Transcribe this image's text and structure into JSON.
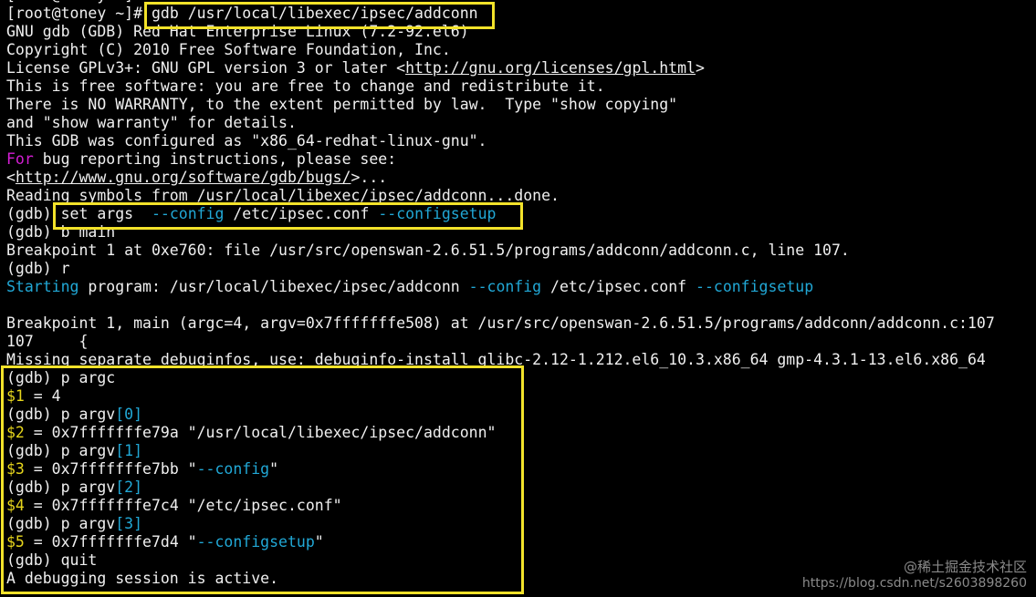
{
  "terminal": {
    "lines": [
      {
        "segments": [
          {
            "text": "[root@toney ~]#",
            "color": "white"
          }
        ]
      },
      {
        "segments": [
          {
            "text": "[root@toney ~]# ",
            "color": "white"
          },
          {
            "text": "gdb /usr/local/libexec/ipsec/addconn",
            "color": "white"
          }
        ]
      },
      {
        "segments": [
          {
            "text": "GNU gdb (GDB) Red Hat Enterprise Linux (7.2-92.el6)",
            "color": "white"
          }
        ]
      },
      {
        "segments": [
          {
            "text": "Copyright (C) 2010 Free Software Foundation, Inc.",
            "color": "white"
          }
        ]
      },
      {
        "segments": [
          {
            "text": "License GPLv3+: GNU GPL version 3 or later <",
            "color": "white"
          },
          {
            "text": "http://gnu.org/licenses/gpl.html",
            "color": "link"
          },
          {
            "text": ">",
            "color": "white"
          }
        ]
      },
      {
        "segments": [
          {
            "text": "This is free software: you are free to change and redistribute it.",
            "color": "white"
          }
        ]
      },
      {
        "segments": [
          {
            "text": "There is NO WARRANTY, to the extent permitted by law.  Type \"show copying\"",
            "color": "white"
          }
        ]
      },
      {
        "segments": [
          {
            "text": "and \"show warranty\" for details.",
            "color": "white"
          }
        ]
      },
      {
        "segments": [
          {
            "text": "This GDB was configured as \"x86_64-redhat-linux-gnu\".",
            "color": "white"
          }
        ]
      },
      {
        "segments": [
          {
            "text": "For",
            "color": "magenta"
          },
          {
            "text": " bug reporting instructions, please see:",
            "color": "white"
          }
        ]
      },
      {
        "segments": [
          {
            "text": "<",
            "color": "white"
          },
          {
            "text": "http://www.gnu.org/software/gdb/bugs/",
            "color": "link"
          },
          {
            "text": ">...",
            "color": "white"
          }
        ]
      },
      {
        "segments": [
          {
            "text": "Reading symbols from /usr/local/libexec/ipsec/addconn...done.",
            "color": "white"
          }
        ]
      },
      {
        "segments": [
          {
            "text": "(gdb) ",
            "color": "white"
          },
          {
            "text": "set args  ",
            "color": "white"
          },
          {
            "text": "--config",
            "color": "cyan"
          },
          {
            "text": " /etc/ipsec.conf ",
            "color": "white"
          },
          {
            "text": "--configsetup",
            "color": "cyan"
          }
        ]
      },
      {
        "segments": [
          {
            "text": "(gdb) b main",
            "color": "white"
          }
        ]
      },
      {
        "segments": [
          {
            "text": "Breakpoint 1 at 0xe760: file /usr/src/openswan-2.6.51.5/programs/addconn/addconn.c, line 107.",
            "color": "white"
          }
        ]
      },
      {
        "segments": [
          {
            "text": "(gdb) r",
            "color": "white"
          }
        ]
      },
      {
        "segments": [
          {
            "text": "Starting",
            "color": "cyan"
          },
          {
            "text": " program: /usr/local/libexec/ipsec/addconn ",
            "color": "white"
          },
          {
            "text": "--config",
            "color": "cyan"
          },
          {
            "text": " /etc/ipsec.conf ",
            "color": "white"
          },
          {
            "text": "--configsetup",
            "color": "cyan"
          }
        ]
      },
      {
        "segments": [
          {
            "text": "",
            "color": "white"
          }
        ]
      },
      {
        "segments": [
          {
            "text": "Breakpoint 1, main (argc=4, argv=0x7fffffffe508) at /usr/src/openswan-2.6.51.5/programs/addconn/addconn.c:107",
            "color": "white"
          }
        ]
      },
      {
        "segments": [
          {
            "text": "107     {",
            "color": "white"
          }
        ]
      },
      {
        "segments": [
          {
            "text": "Missing separate debuginfos, use: debuginfo-install glibc-2.12-1.212.el6_10.3.x86_64 gmp-4.3.1-13.el6.x86_64",
            "color": "white"
          }
        ]
      },
      {
        "segments": [
          {
            "text": "(gdb) p argc",
            "color": "white"
          }
        ]
      },
      {
        "segments": [
          {
            "text": "$1",
            "color": "yellow"
          },
          {
            "text": " = 4",
            "color": "white"
          }
        ]
      },
      {
        "segments": [
          {
            "text": "(gdb) p argv",
            "color": "white"
          },
          {
            "text": "[0]",
            "color": "cyan"
          }
        ]
      },
      {
        "segments": [
          {
            "text": "$2",
            "color": "yellow"
          },
          {
            "text": " = 0x7fffffffe79a \"/usr/local/libexec/ipsec/addconn\"",
            "color": "white"
          }
        ]
      },
      {
        "segments": [
          {
            "text": "(gdb) p argv",
            "color": "white"
          },
          {
            "text": "[1]",
            "color": "cyan"
          }
        ]
      },
      {
        "segments": [
          {
            "text": "$3",
            "color": "yellow"
          },
          {
            "text": " = 0x7fffffffe7bb \"",
            "color": "white"
          },
          {
            "text": "--config",
            "color": "cyan"
          },
          {
            "text": "\"",
            "color": "white"
          }
        ]
      },
      {
        "segments": [
          {
            "text": "(gdb) p argv",
            "color": "white"
          },
          {
            "text": "[2]",
            "color": "cyan"
          }
        ]
      },
      {
        "segments": [
          {
            "text": "$4",
            "color": "yellow"
          },
          {
            "text": " = 0x7fffffffe7c4 \"/etc/ipsec.conf\"",
            "color": "white"
          }
        ]
      },
      {
        "segments": [
          {
            "text": "(gdb) p argv",
            "color": "white"
          },
          {
            "text": "[3]",
            "color": "cyan"
          }
        ]
      },
      {
        "segments": [
          {
            "text": "$5",
            "color": "yellow"
          },
          {
            "text": " = 0x7fffffffe7d4 \"",
            "color": "white"
          },
          {
            "text": "--configsetup",
            "color": "cyan"
          },
          {
            "text": "\"",
            "color": "white"
          }
        ]
      },
      {
        "segments": [
          {
            "text": "(gdb) quit",
            "color": "white"
          }
        ]
      },
      {
        "segments": [
          {
            "text": "A debugging session is active.",
            "color": "white"
          }
        ]
      }
    ]
  },
  "watermark": {
    "line1": "@稀土掘金技术社区",
    "line2": "https://blog.csdn.net/s2603898260"
  },
  "colors": {
    "background": "#000000",
    "text": "#f0f0f0",
    "cyan": "#21a8d6",
    "magenta": "#d41ed4",
    "yellow_dollar": "#e6d51c",
    "highlight_box": "#f2e22a"
  }
}
